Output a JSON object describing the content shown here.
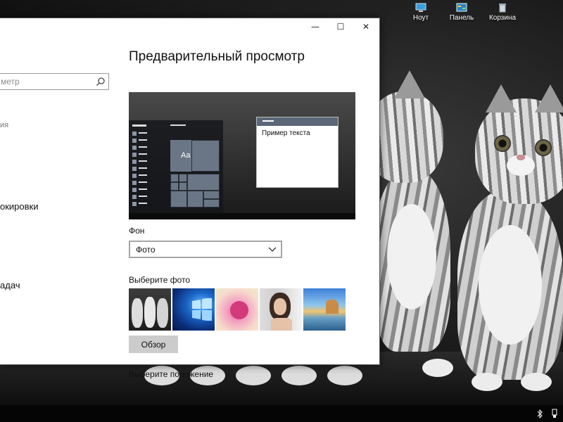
{
  "desktop": {
    "icons": [
      {
        "label": "Ноут"
      },
      {
        "label": "Панель"
      },
      {
        "label": "Корзина"
      }
    ]
  },
  "window": {
    "controls": {
      "minimize": "—",
      "maximize": "☐",
      "close": "✕"
    },
    "sidebar": {
      "search_text": "метр",
      "category_text": "ия",
      "item_lock": "окировки",
      "item_taskbar": "адач"
    },
    "content": {
      "title": "Предварительный просмотр",
      "preview": {
        "tile_text": "Aa",
        "dialog_text": "Пример текста"
      },
      "background_label": "Фон",
      "background_value": "Фото",
      "choose_photo_label": "Выберите фото",
      "browse_label": "Обзор",
      "choose_position_label": "Выберите положение"
    }
  },
  "colors": {
    "accent": "#5c6878",
    "window_bg": "#ffffff",
    "button_bg": "#cccccc"
  }
}
